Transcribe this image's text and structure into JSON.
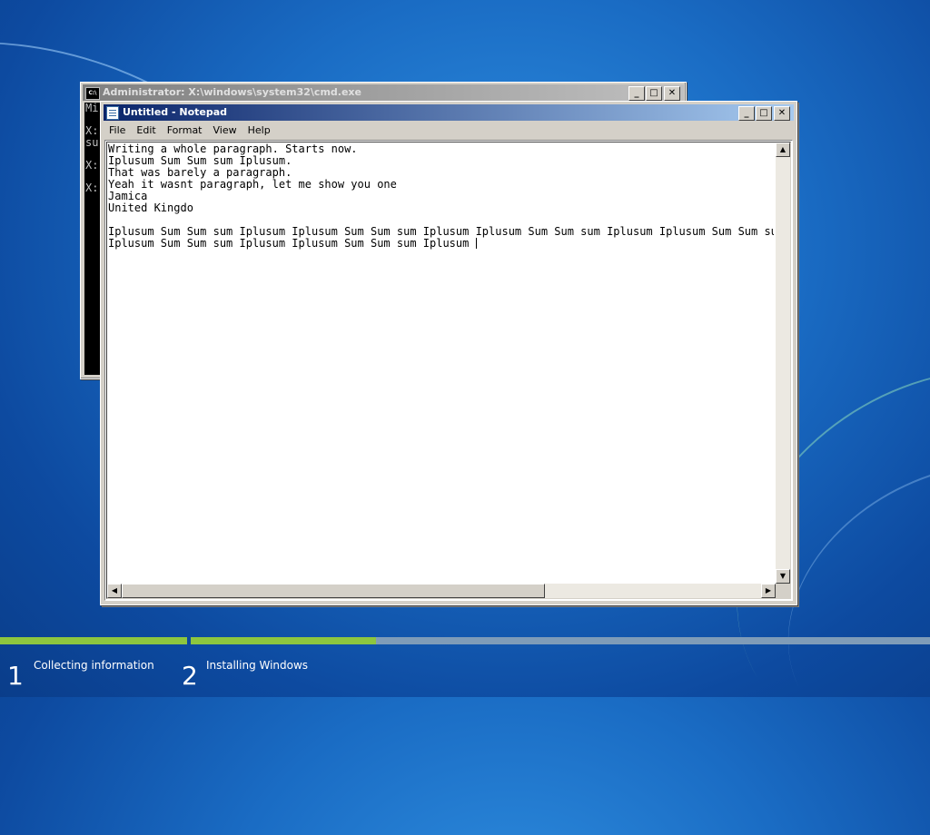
{
  "cmd_window": {
    "title": "Administrator: X:\\windows\\system32\\cmd.exe",
    "icon": "cmd-icon",
    "visible_text": "Mi\n\nX:\nsu\n\nX:\n\nX:"
  },
  "notepad": {
    "title": "Untitled - Notepad",
    "icon": "notepad-icon",
    "menu": [
      "File",
      "Edit",
      "Format",
      "View",
      "Help"
    ],
    "text_lines": [
      "Writing a whole paragraph. Starts now.",
      "Iplusum Sum Sum sum Iplusum.",
      "That was barely a paragraph.",
      "Yeah it wasnt paragraph, let me show you one",
      "Jamica",
      "United Kingdo",
      "",
      "Iplusum Sum Sum sum Iplusum Iplusum Sum Sum sum Iplusum Iplusum Sum Sum sum Iplusum Iplusum Sum Sum sum Iplusum",
      "Iplusum Sum Sum sum Iplusum Iplusum Sum Sum sum Iplusum "
    ]
  },
  "window_buttons": {
    "minimize": "_",
    "maximize": "□",
    "close": "✕"
  },
  "setup_steps": [
    {
      "number": "1",
      "label": "Collecting information"
    },
    {
      "number": "2",
      "label": "Installing Windows"
    }
  ],
  "colors": {
    "progress_done": "#8dc63f",
    "progress_track": "#7f9cb8",
    "desktop": "#1a6cc4"
  },
  "progress": {
    "step1_fraction": 1.0,
    "step2_fraction": 0.25
  }
}
